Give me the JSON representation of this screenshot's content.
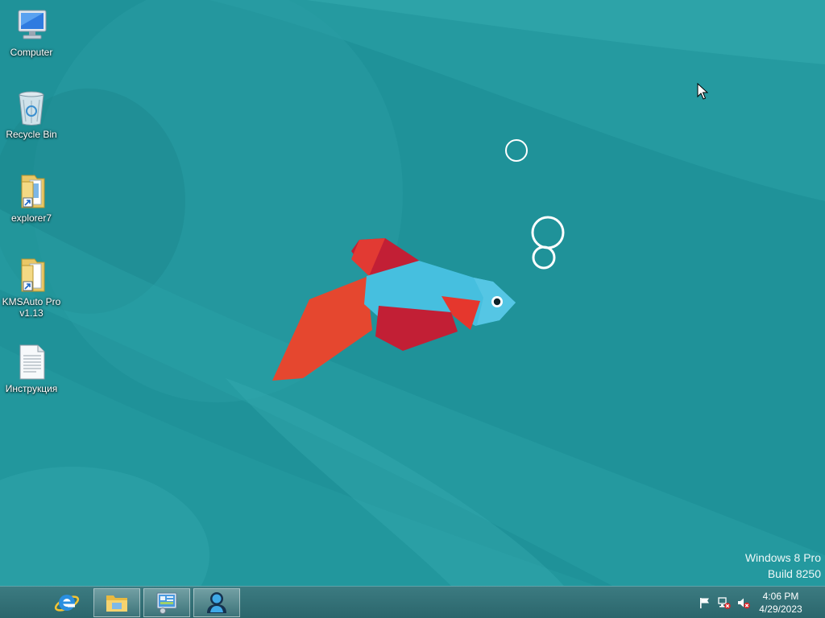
{
  "desktop": {
    "icons": [
      {
        "name": "computer-icon",
        "label": "Computer"
      },
      {
        "name": "recycle-bin-icon",
        "label": "Recycle Bin"
      },
      {
        "name": "folder-shortcut-icon",
        "label": "explorer7"
      },
      {
        "name": "folder-shortcut-icon",
        "label": "KMSAuto Pro v1.13"
      },
      {
        "name": "text-document-icon",
        "label": "Инструкция"
      }
    ],
    "watermark": {
      "line1": "Windows 8 Pro",
      "line2": "Build 8250"
    },
    "background_color": "#1f9299"
  },
  "taskbar": {
    "pinned": [
      {
        "name": "internet-explorer-icon"
      },
      {
        "name": "file-explorer-icon"
      },
      {
        "name": "control-panel-icon"
      },
      {
        "name": "user-app-icon"
      }
    ],
    "tray": {
      "icons": [
        "action-center-flag-icon",
        "network-disconnected-icon",
        "volume-muted-icon"
      ],
      "time": "4:06 PM",
      "date": "4/29/2023"
    }
  }
}
